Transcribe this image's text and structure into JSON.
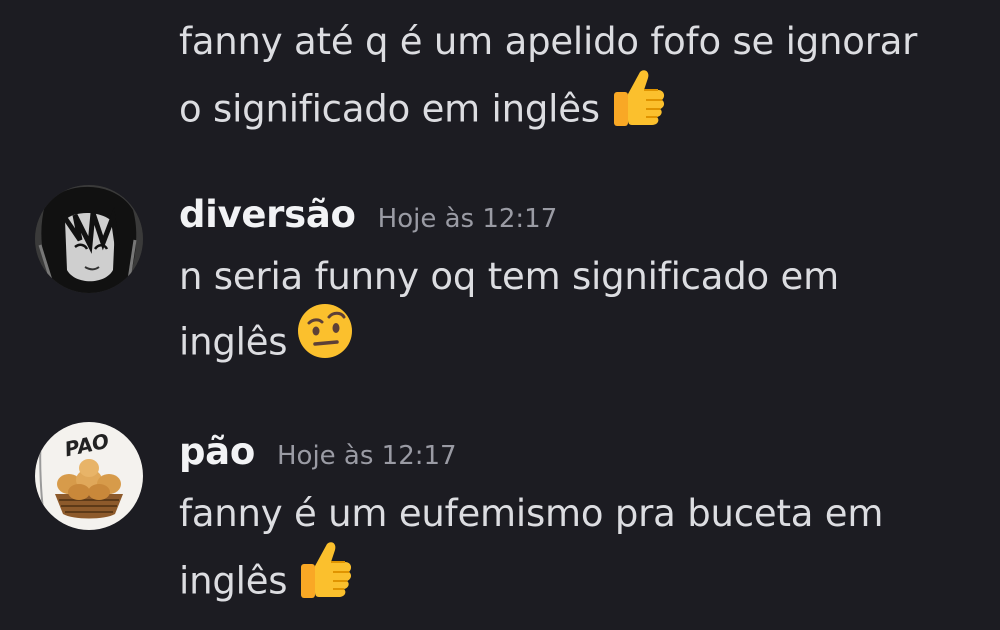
{
  "messages": [
    {
      "continuation": true,
      "text_line1": "fanny até q é um apelido fofo se ignorar",
      "text_line2": "o significado em inglês",
      "emoji": "thumbs-up-icon"
    },
    {
      "username": "diversão",
      "timestamp": "Hoje às 12:17",
      "text_line1": "n seria funny oq tem significado em",
      "text_line2": "inglês",
      "emoji": "face-with-raised-eyebrow-icon",
      "avatar": "anime-character-avatar"
    },
    {
      "username": "pão",
      "timestamp": "Hoje às 12:17",
      "text_line1": "fanny é um eufemismo pra buceta em",
      "text_line2": "inglês",
      "emoji": "thumbs-up-icon",
      "avatar": "bread-basket-avatar",
      "avatar_text": "PAO"
    }
  ],
  "colors": {
    "background": "#1c1c22",
    "text": "#dcdde1",
    "username": "#f2f3f5",
    "timestamp": "#9a9ba4"
  }
}
